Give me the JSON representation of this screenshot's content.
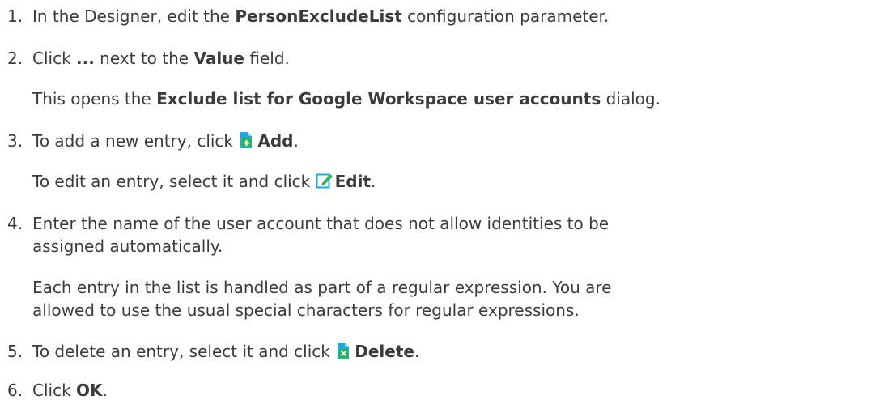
{
  "steps": [
    {
      "number": "1.",
      "before": "In the Designer, edit the ",
      "bold": "PersonExcludeList",
      "after": " configuration parameter."
    },
    {
      "number": "2.",
      "before": "Click ",
      "bold": "...",
      "middle": " next to the ",
      "bold2": "Value",
      "after": " field.",
      "note_before": "This opens the ",
      "note_bold": "Exclude list for Google Workspace user accounts",
      "note_after": " dialog."
    },
    {
      "number": "3.",
      "before": "To add a new entry, click ",
      "icon": "add-document-icon",
      "bold": "Add",
      "after": ".",
      "note_before": "To edit an entry, select it and click ",
      "note_icon": "edit-icon",
      "note_bold": "Edit",
      "note_after": "."
    },
    {
      "number": "4.",
      "line1": "Enter the name of the user account that does not allow identities to be",
      "line2": "assigned automatically.",
      "note_line1": "Each entry in the list is handled as part of a regular expression. You are",
      "note_line2": "allowed to use the usual special characters for regular expressions."
    },
    {
      "number": "5.",
      "before": "To delete an entry, select it and click ",
      "icon": "delete-document-icon",
      "bold": "Delete",
      "after": "."
    },
    {
      "number": "6.",
      "before": "Click ",
      "bold": "OK",
      "after": "."
    }
  ],
  "colors": {
    "text": "#3b3b3b",
    "icon_green": "#2fb44a",
    "icon_blue": "#1ea7e1"
  }
}
